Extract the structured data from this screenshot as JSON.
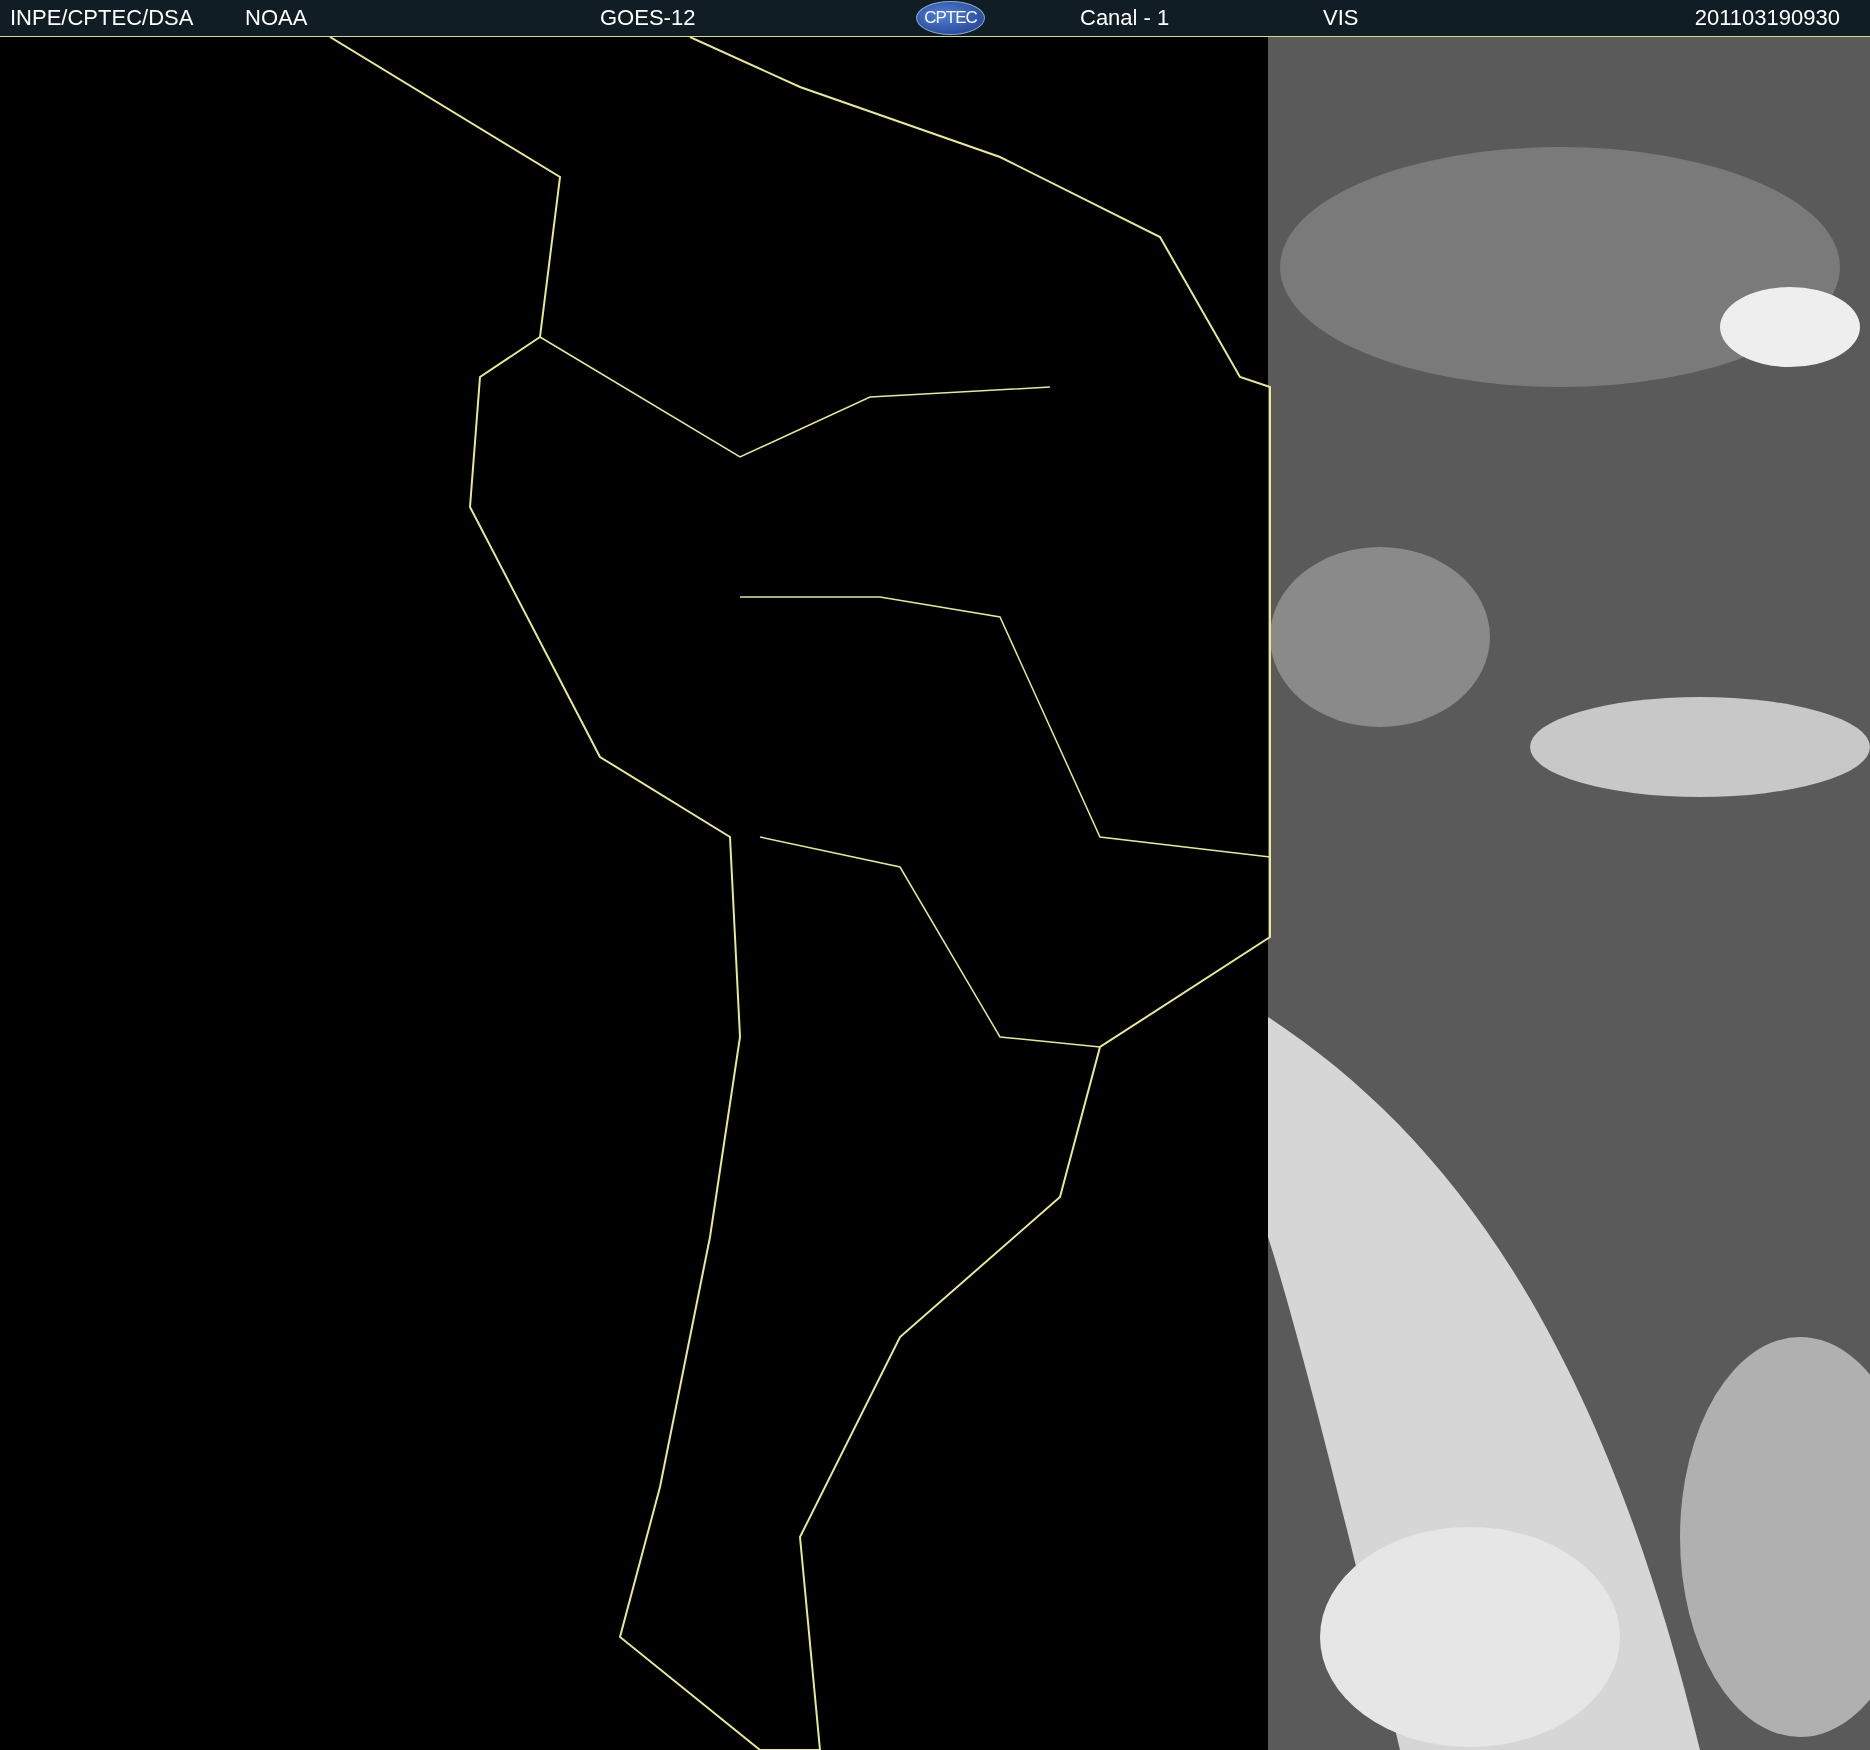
{
  "header": {
    "source": "INPE/CPTEC/DSA",
    "agency": "NOAA",
    "satellite": "GOES-12",
    "logo": "CPTEC",
    "channel": "Canal - 1",
    "band": "VIS",
    "timestamp": "201103190930"
  }
}
